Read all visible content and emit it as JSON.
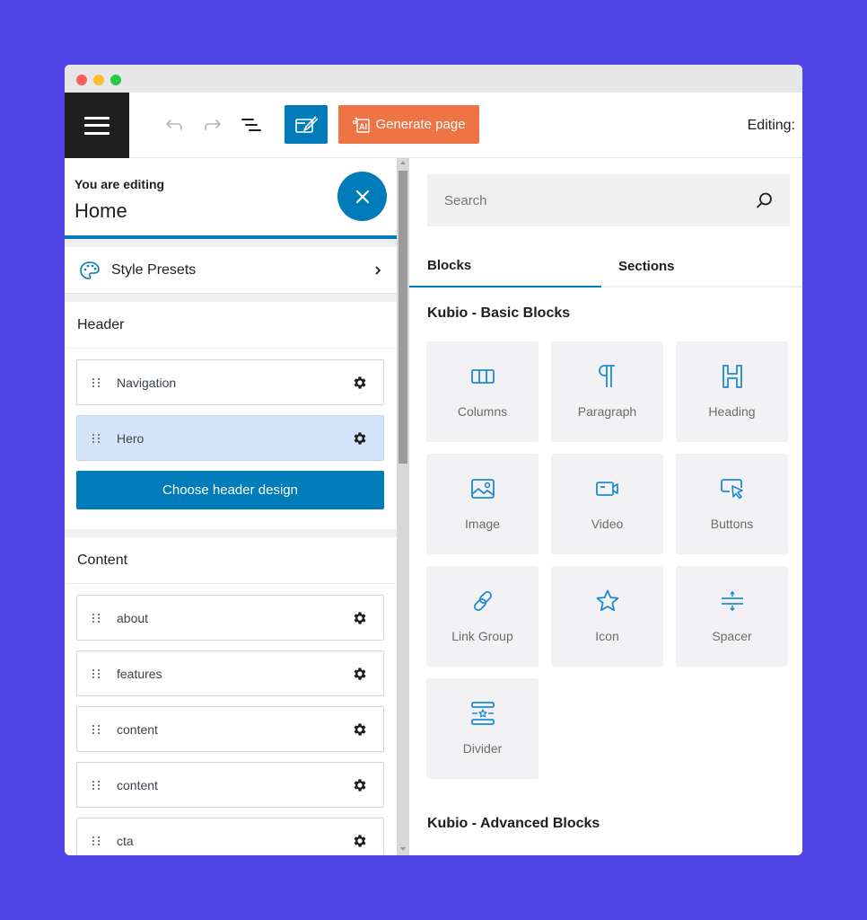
{
  "window": {
    "traffic_lights": [
      "close",
      "minimize",
      "maximize"
    ]
  },
  "toolbar": {
    "menu_icon": "hamburger-icon",
    "undo_icon": "undo-icon",
    "redo_icon": "redo-icon",
    "list_view_icon": "list-view-icon",
    "style_icon": "style-brush-icon",
    "generate_label": "Generate page",
    "generate_icon": "ai-icon",
    "editing_label": "Editing:",
    "colors": {
      "primary": "#007cba",
      "generate": "#ee7445",
      "menu_bg": "#1e1e1e"
    }
  },
  "left_panel": {
    "editing_caption": "You are editing",
    "editing_page": "Home",
    "close_icon": "close-icon",
    "style_presets_label": "Style Presets",
    "header_section": {
      "title": "Header",
      "items": [
        {
          "label": "Navigation",
          "active": false
        },
        {
          "label": "Hero",
          "active": true
        }
      ],
      "choose_button": "Choose header design"
    },
    "content_section": {
      "title": "Content",
      "items": [
        {
          "label": "about"
        },
        {
          "label": "features"
        },
        {
          "label": "content"
        },
        {
          "label": "content"
        },
        {
          "label": "cta"
        }
      ]
    }
  },
  "right_panel": {
    "search_placeholder": "Search",
    "tabs": [
      {
        "label": "Blocks",
        "active": true
      },
      {
        "label": "Sections",
        "active": false
      }
    ],
    "basic_title": "Kubio - Basic Blocks",
    "blocks": [
      {
        "label": "Columns",
        "icon": "columns-icon"
      },
      {
        "label": "Paragraph",
        "icon": "paragraph-icon"
      },
      {
        "label": "Heading",
        "icon": "heading-icon"
      },
      {
        "label": "Image",
        "icon": "image-icon"
      },
      {
        "label": "Video",
        "icon": "video-icon"
      },
      {
        "label": "Buttons",
        "icon": "buttons-icon"
      },
      {
        "label": "Link Group",
        "icon": "link-icon"
      },
      {
        "label": "Icon",
        "icon": "star-icon"
      },
      {
        "label": "Spacer",
        "icon": "spacer-icon"
      },
      {
        "label": "Divider",
        "icon": "divider-icon"
      }
    ],
    "advanced_title": "Kubio - Advanced Blocks"
  }
}
